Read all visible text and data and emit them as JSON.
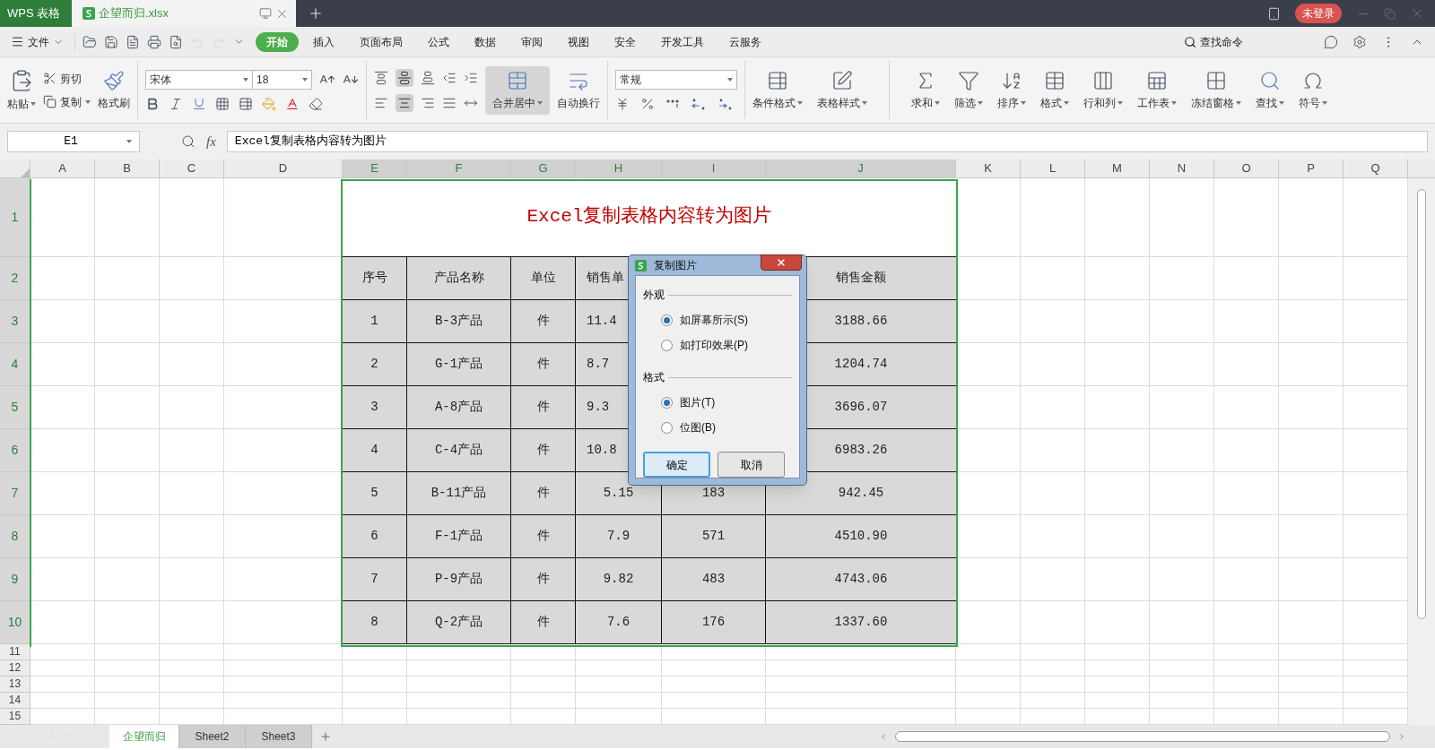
{
  "title_bar": {
    "app_tab": "WPS 表格",
    "doc_tab": "企望而归.xlsx",
    "login": "未登录"
  },
  "menu": {
    "file": "文件",
    "tabs": [
      {
        "label": "开始",
        "selected": true
      },
      {
        "label": "插入",
        "selected": false
      },
      {
        "label": "页面布局",
        "selected": false
      },
      {
        "label": "公式",
        "selected": false
      },
      {
        "label": "数据",
        "selected": false
      },
      {
        "label": "审阅",
        "selected": false
      },
      {
        "label": "视图",
        "selected": false
      },
      {
        "label": "安全",
        "selected": false
      },
      {
        "label": "开发工具",
        "selected": false
      },
      {
        "label": "云服务",
        "selected": false
      }
    ],
    "search": "查找命令"
  },
  "ribbon": {
    "paste": "粘贴",
    "cut": "剪切",
    "copy": "复制",
    "format_painter": "格式刷",
    "font_name": "宋体",
    "font_size": "18",
    "merge": "合并居中",
    "wrap": "自动换行",
    "number_format": "常规",
    "tools": [
      {
        "label": "条件格式",
        "kind": "condformat"
      },
      {
        "label": "表格样式",
        "kind": "tablestyle"
      },
      {
        "label": "求和",
        "kind": "sum"
      },
      {
        "label": "筛选",
        "kind": "filter"
      },
      {
        "label": "排序",
        "kind": "sort"
      },
      {
        "label": "格式",
        "kind": "format"
      },
      {
        "label": "行和列",
        "kind": "rowcol"
      },
      {
        "label": "工作表",
        "kind": "sheet"
      },
      {
        "label": "冻结窗格",
        "kind": "freeze"
      },
      {
        "label": "查找",
        "kind": "find"
      },
      {
        "label": "符号",
        "kind": "symbol"
      }
    ]
  },
  "formula_bar": {
    "cell": "E1",
    "fx": "fx",
    "content": "Excel复制表格内容转为图片"
  },
  "columns": [
    {
      "label": "A",
      "selected": false
    },
    {
      "label": "B",
      "selected": false
    },
    {
      "label": "C",
      "selected": false
    },
    {
      "label": "D",
      "selected": false
    },
    {
      "label": "E",
      "selected": true
    },
    {
      "label": "F",
      "selected": true
    },
    {
      "label": "G",
      "selected": true
    },
    {
      "label": "H",
      "selected": true
    },
    {
      "label": "I",
      "selected": true
    },
    {
      "label": "J",
      "selected": true
    },
    {
      "label": "K",
      "selected": false
    },
    {
      "label": "L",
      "selected": false
    },
    {
      "label": "M",
      "selected": false
    },
    {
      "label": "N",
      "selected": false
    },
    {
      "label": "O",
      "selected": false
    },
    {
      "label": "P",
      "selected": false
    },
    {
      "label": "Q",
      "selected": false
    }
  ],
  "row_headers": [
    {
      "label": "1",
      "selected": true
    },
    {
      "label": "2",
      "selected": true
    },
    {
      "label": "3",
      "selected": true
    },
    {
      "label": "4",
      "selected": true
    },
    {
      "label": "5",
      "selected": true
    },
    {
      "label": "6",
      "selected": true
    },
    {
      "label": "7",
      "selected": true
    },
    {
      "label": "8",
      "selected": true
    },
    {
      "label": "9",
      "selected": true
    },
    {
      "label": "10",
      "selected": true
    },
    {
      "label": "11",
      "selected": false
    },
    {
      "label": "12",
      "selected": false
    },
    {
      "label": "13",
      "selected": false
    },
    {
      "label": "14",
      "selected": false
    },
    {
      "label": "15",
      "selected": false
    }
  ],
  "table": {
    "title": "Excel复制表格内容转为图片",
    "header": {
      "no": "序号",
      "product": "产品名称",
      "unit": "单位",
      "price": "销售单",
      "amount": "销售金额"
    },
    "rows": [
      {
        "no": "1",
        "product": "B-3产品",
        "unit": "件",
        "price": "11.4",
        "amount": "3188.66"
      },
      {
        "no": "2",
        "product": "G-1产品",
        "unit": "件",
        "price": "8.7",
        "amount": "1204.74"
      },
      {
        "no": "3",
        "product": "A-8产品",
        "unit": "件",
        "price": "9.3",
        "amount": "3696.07"
      },
      {
        "no": "4",
        "product": "C-4产品",
        "unit": "件",
        "price": "10.8",
        "amount": "6983.26"
      },
      {
        "no": "5",
        "product": "B-11产品",
        "unit": "件",
        "price": "5.15",
        "qty": "183",
        "amount": "942.45"
      },
      {
        "no": "6",
        "product": "F-1产品",
        "unit": "件",
        "price": "7.9",
        "qty": "571",
        "amount": "4510.90"
      },
      {
        "no": "7",
        "product": "P-9产品",
        "unit": "件",
        "price": "9.82",
        "qty": "483",
        "amount": "4743.06"
      },
      {
        "no": "8",
        "product": "Q-2产品",
        "unit": "件",
        "price": "7.6",
        "qty": "176",
        "amount": "1337.60"
      }
    ]
  },
  "dialog": {
    "title": "复制图片",
    "appearance_label": "外观",
    "appearance_options": [
      {
        "label": "如屏幕所示(S)",
        "selected": true
      },
      {
        "label": "如打印效果(P)",
        "selected": false
      }
    ],
    "format_label": "格式",
    "format_options": [
      {
        "label": "图片(T)",
        "selected": true
      },
      {
        "label": "位图(B)",
        "selected": false
      }
    ],
    "ok": "确定",
    "cancel": "取消"
  },
  "sheet_tabs": [
    {
      "label": "企望而归",
      "selected": true
    },
    {
      "label": "Sheet2",
      "selected": false
    },
    {
      "label": "Sheet3",
      "selected": false
    }
  ]
}
